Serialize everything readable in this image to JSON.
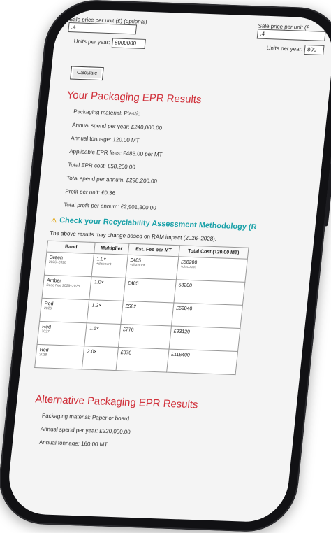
{
  "form": {
    "sale_price_label": "Sale price per unit (£) (optional)",
    "sale_price_value": ".4",
    "units_label": "Units per year:",
    "units_value": "8000000",
    "right_sale_price_label": "Sale price per unit (£",
    "right_sale_price_value": ".4",
    "right_units_label": "Units per year:",
    "right_units_value": "800"
  },
  "calculate_label": "Calculate",
  "results": {
    "title": "Your Packaging EPR Results",
    "lines": [
      "Packaging material: Plastic",
      "Annual spend per year: £240,000.00",
      "Annual tonnage: 120.00 MT",
      "Applicable EPR fees: £485.00 per MT",
      "Total EPR cost: £58,200.00",
      "Total spend per annum: £298,200.00",
      "Profit per unit: £0.36",
      "Total profit per annum: £2,901,800.00"
    ]
  },
  "check": {
    "title": "Check your Recyclability Assessment Methodology (R",
    "note": "The above results may change based on RAM impact (2026–2028)."
  },
  "table": {
    "headers": [
      "Band",
      "Multiplier",
      "Est. Fee per MT",
      "Total Cost (120.00 MT)"
    ],
    "rows": [
      {
        "band": "Green",
        "band_sub": "2026–2028",
        "mult": "1.0×",
        "mult_sub": "+discount",
        "fee": "£485",
        "fee_sub": "+discount",
        "total": "£58200",
        "total_sub": "+discount"
      },
      {
        "band": "Amber",
        "band_sub": "Base Fee 2026–2028",
        "mult": "1.0×",
        "mult_sub": "",
        "fee": "£485",
        "fee_sub": "",
        "total": "58200",
        "total_sub": ""
      },
      {
        "band": "Red",
        "band_sub": "2026",
        "mult": "1.2×",
        "mult_sub": "",
        "fee": "£582",
        "fee_sub": "",
        "total": "£69840",
        "total_sub": ""
      },
      {
        "band": "Red",
        "band_sub": "2027",
        "mult": "1.6×",
        "mult_sub": "",
        "fee": "£776",
        "fee_sub": "",
        "total": "£93120",
        "total_sub": ""
      },
      {
        "band": "Red",
        "band_sub": "2028",
        "mult": "2.0×",
        "mult_sub": "",
        "fee": "£970",
        "fee_sub": "",
        "total": "£116400",
        "total_sub": ""
      }
    ]
  },
  "alternative": {
    "title": "Alternative Packaging EPR Results",
    "lines": [
      "Packaging material: Paper or board",
      "Annual spend per year: £320,000.00",
      "Annual tonnage: 160.00 MT"
    ]
  },
  "colors": {
    "heading_red": "#d0303a",
    "check_teal": "#1aa1a8",
    "warning": "#e0a000",
    "phone": "#111114"
  }
}
